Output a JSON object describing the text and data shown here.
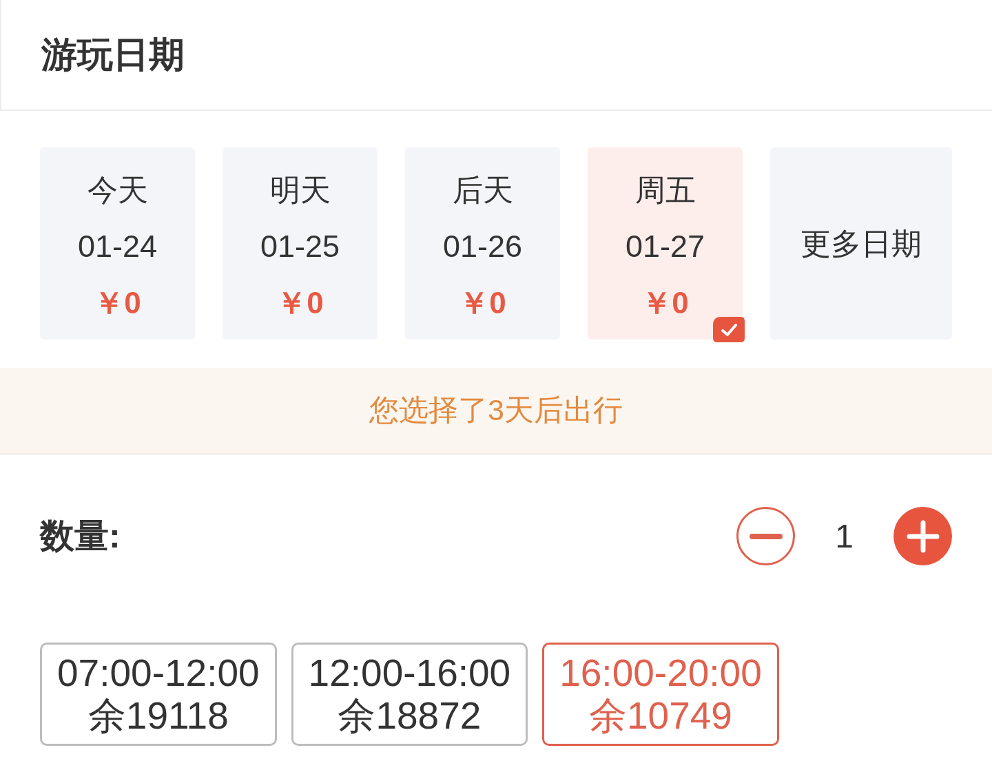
{
  "header": {
    "title": "游玩日期"
  },
  "dates": [
    {
      "kind": "day",
      "label": "今天",
      "date": "01-24",
      "price": "￥0",
      "selected": false
    },
    {
      "kind": "day",
      "label": "明天",
      "date": "01-25",
      "price": "￥0",
      "selected": false
    },
    {
      "kind": "day",
      "label": "后天",
      "date": "01-26",
      "price": "￥0",
      "selected": false
    },
    {
      "kind": "day",
      "label": "周五",
      "date": "01-27",
      "price": "￥0",
      "selected": true
    },
    {
      "kind": "more",
      "label": "更多日期",
      "selected": false
    }
  ],
  "notice": "您选择了3天后出行",
  "quantity": {
    "label": "数量:",
    "value": "1"
  },
  "time_slots": [
    {
      "time": "07:00-12:00",
      "remaining": "余19118",
      "selected": false
    },
    {
      "time": "12:00-16:00",
      "remaining": "余18872",
      "selected": false
    },
    {
      "time": "16:00-20:00",
      "remaining": "余10749",
      "selected": true
    }
  ]
}
